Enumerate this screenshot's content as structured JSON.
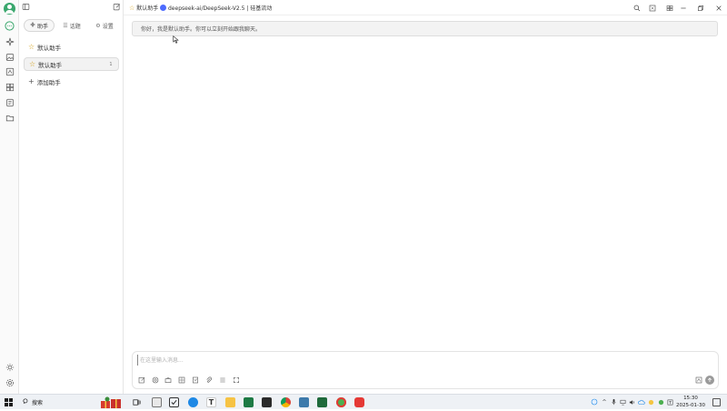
{
  "panel": {
    "tabs": [
      {
        "label": "助手",
        "icon": "sparkle-icon"
      },
      {
        "label": "话题",
        "icon": "list-icon"
      },
      {
        "label": "设置",
        "icon": "gear-icon"
      }
    ],
    "assistants": [
      {
        "label": "默认助手",
        "icon": "star-icon"
      },
      {
        "label": "默认助手",
        "icon": "star-icon",
        "count": "1",
        "selected": true
      }
    ],
    "add_label": "添加助手"
  },
  "topbar": {
    "assistant_name": "默认助手",
    "model_name": "deepseek-ai/DeepSeek-V2.5 | 硅基流动"
  },
  "chat": {
    "greeting": "你好，我是默认助手。你可以立刻开始跟我聊天。"
  },
  "input": {
    "placeholder": "在这里输入消息..."
  },
  "taskbar": {
    "search_label": "搜索",
    "time": "15:30",
    "date": "2025-01-30"
  },
  "colors": {
    "accent": "#3aa76d",
    "model_icon": "#4d6bfe"
  }
}
